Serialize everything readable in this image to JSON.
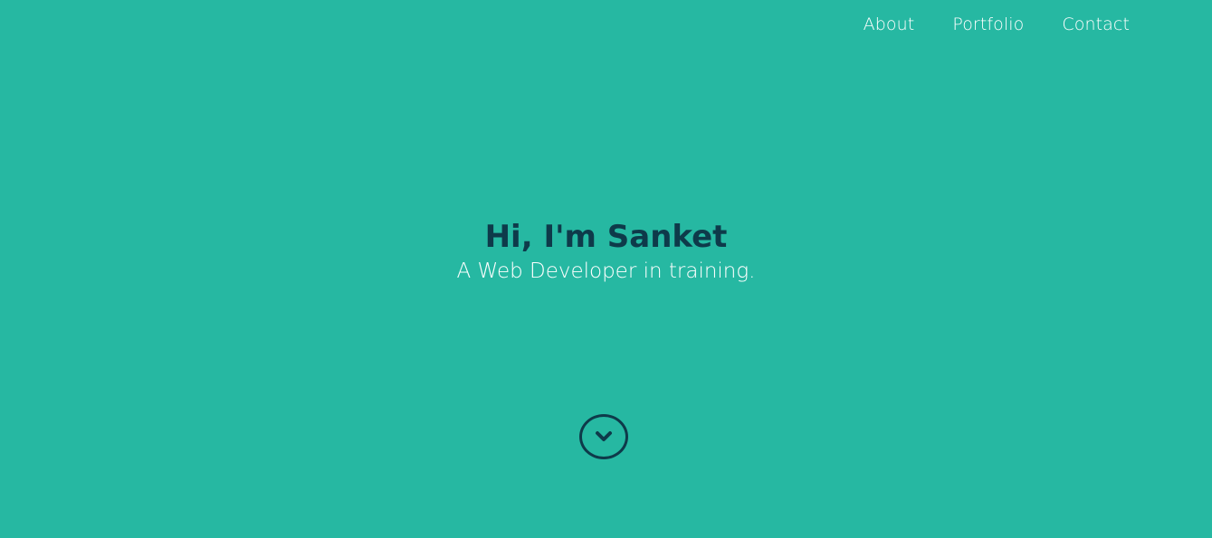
{
  "nav": {
    "items": [
      {
        "label": "About"
      },
      {
        "label": "Portfolio"
      },
      {
        "label": "Contact"
      }
    ]
  },
  "hero": {
    "title": "Hi, I'm Sanket",
    "subtitle": "A Web Developer in training."
  },
  "scroll_button": {
    "icon": "chevron-down-icon"
  },
  "colors": {
    "background": "#26b8a2",
    "title": "#0e3a4a",
    "text": "#ffffff"
  }
}
